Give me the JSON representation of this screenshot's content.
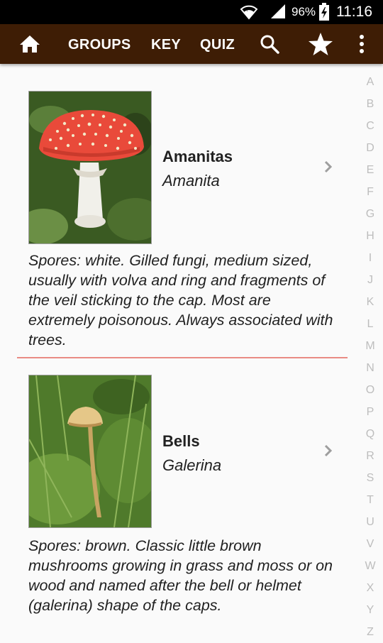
{
  "status_bar": {
    "battery": "96%",
    "time": "11:16"
  },
  "app_bar": {
    "nav": [
      "GROUPS",
      "KEY",
      "QUIZ"
    ],
    "icons": [
      "home-icon",
      "search-icon",
      "star-icon",
      "more-vert-icon"
    ],
    "color": "#3e1d05"
  },
  "alphabet": [
    "A",
    "B",
    "C",
    "D",
    "E",
    "F",
    "G",
    "H",
    "I",
    "J",
    "K",
    "L",
    "M",
    "N",
    "O",
    "P",
    "Q",
    "R",
    "S",
    "T",
    "U",
    "V",
    "W",
    "X",
    "Y",
    "Z"
  ],
  "groups": [
    {
      "name": "Amanitas",
      "latin": "Amanita",
      "description": "Spores: white. Gilled fungi, medium sized, usually with volva and ring and fragments of the veil sticking to the cap. Most are extremely poisonous. Always associated with trees."
    },
    {
      "name": "Bells",
      "latin": "Galerina",
      "description": "Spores: brown. Classic little brown mushrooms growing in grass and moss or on wood and named after the bell or helmet (galerina) shape of the caps."
    }
  ],
  "colors": {
    "divider": "#e98b84",
    "index_letter": "#bdbdbd"
  }
}
